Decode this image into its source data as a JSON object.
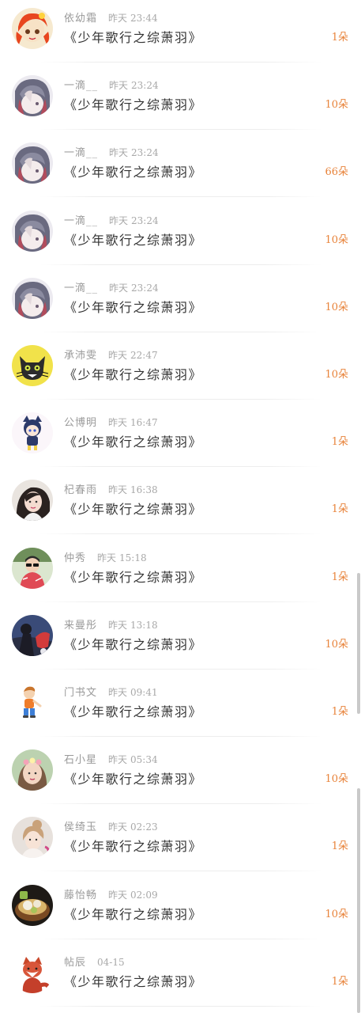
{
  "book_title": "少年歌行之综萧羽",
  "unit": "朵",
  "rows": [
    {
      "user": "依幼霜",
      "date": "昨天",
      "time": "23:44",
      "count": "1",
      "avatar": "red-haired-girl-avatar"
    },
    {
      "user": "一滴__",
      "date": "昨天",
      "time": "23:24",
      "count": "10",
      "avatar": "anime-girl-sketch-avatar"
    },
    {
      "user": "一滴__",
      "date": "昨天",
      "time": "23:24",
      "count": "66",
      "avatar": "anime-girl-sketch-avatar"
    },
    {
      "user": "一滴__",
      "date": "昨天",
      "time": "23:24",
      "count": "10",
      "avatar": "anime-girl-sketch-avatar"
    },
    {
      "user": "一滴__",
      "date": "昨天",
      "time": "23:24",
      "count": "10",
      "avatar": "anime-girl-sketch-avatar"
    },
    {
      "user": "承沛雯",
      "date": "昨天",
      "time": "22:47",
      "count": "10",
      "avatar": "black-cat-avatar"
    },
    {
      "user": "公博明",
      "date": "昨天",
      "time": "16:47",
      "count": "1",
      "avatar": "chibi-cat-girl-avatar"
    },
    {
      "user": "杞春雨",
      "date": "昨天",
      "time": "16:38",
      "count": "1",
      "avatar": "woman-portrait-avatar"
    },
    {
      "user": "仲秀",
      "date": "昨天",
      "time": "15:18",
      "count": "1",
      "avatar": "child-sunglasses-avatar"
    },
    {
      "user": "来曼彤",
      "date": "昨天",
      "time": "13:18",
      "count": "10",
      "avatar": "dark-figure-avatar"
    },
    {
      "user": "门书文",
      "date": "昨天",
      "time": "09:41",
      "count": "1",
      "avatar": "cartoon-boy-avatar"
    },
    {
      "user": "石小星",
      "date": "昨天",
      "time": "05:34",
      "count": "10",
      "avatar": "boy-flower-crown-avatar"
    },
    {
      "user": "侯绮玉",
      "date": "昨天",
      "time": "02:23",
      "count": "1",
      "avatar": "girl-bun-avatar"
    },
    {
      "user": "藤怡畅",
      "date": "昨天",
      "time": "02:09",
      "count": "10",
      "avatar": "food-bowl-avatar"
    },
    {
      "user": "帖辰",
      "date": "",
      "time": "04-15",
      "count": "1",
      "avatar": "red-fox-avatar"
    }
  ]
}
